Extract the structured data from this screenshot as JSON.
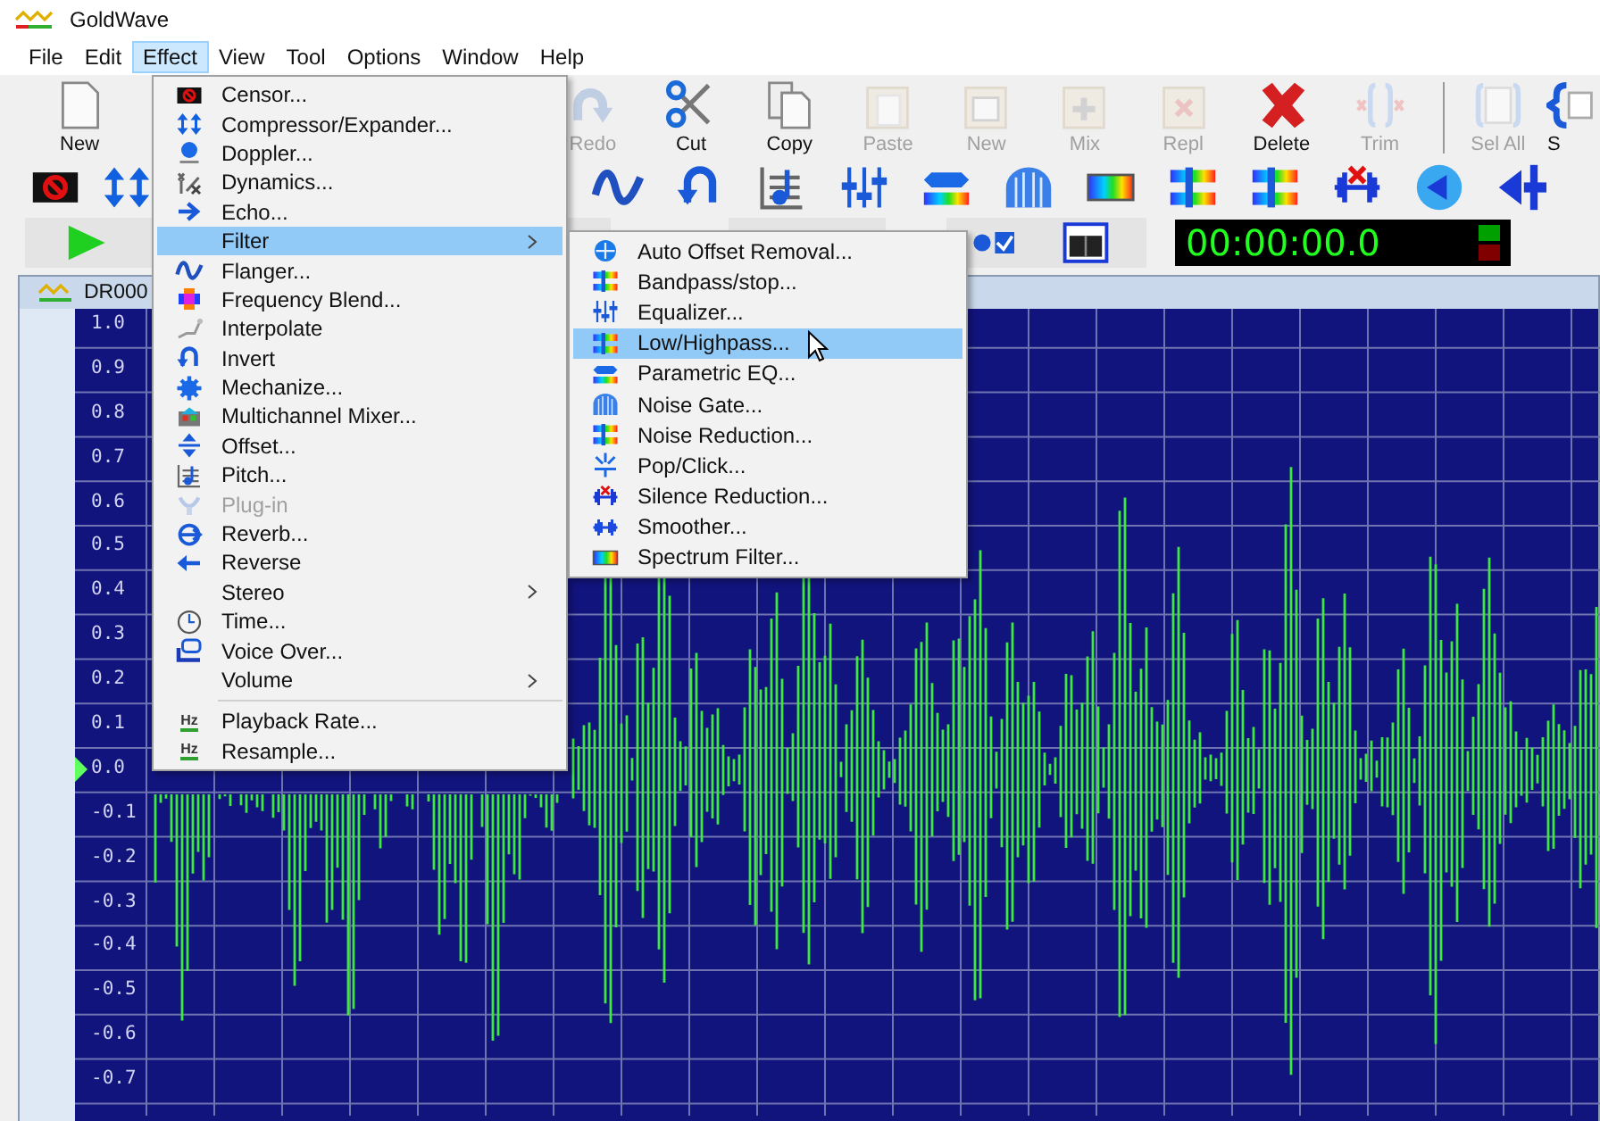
{
  "window": {
    "title": "GoldWave"
  },
  "menu_bar": [
    {
      "label": "File",
      "selected": false
    },
    {
      "label": "Edit",
      "selected": false
    },
    {
      "label": "Effect",
      "selected": true
    },
    {
      "label": "View",
      "selected": false
    },
    {
      "label": "Tool",
      "selected": false
    },
    {
      "label": "Options",
      "selected": false
    },
    {
      "label": "Window",
      "selected": false
    },
    {
      "label": "Help",
      "selected": false
    }
  ],
  "toolbar_left": [
    {
      "label": "New",
      "disabled": false
    }
  ],
  "toolbar_right": [
    {
      "label": "Redo",
      "disabled": true
    },
    {
      "label": "Cut",
      "disabled": false
    },
    {
      "label": "Copy",
      "disabled": false
    },
    {
      "label": "Paste",
      "disabled": true
    },
    {
      "label": "New",
      "disabled": true
    },
    {
      "label": "Mix",
      "disabled": true
    },
    {
      "label": "Repl",
      "disabled": true
    },
    {
      "label": "Delete",
      "disabled": false
    },
    {
      "label": "Trim",
      "disabled": true
    }
  ],
  "toolbar_end": [
    {
      "label": "Sel All",
      "disabled": true
    },
    {
      "label": "S",
      "disabled": false
    }
  ],
  "timer": {
    "value": "00:00:00.0"
  },
  "document": {
    "title": "DR000",
    "y_axis_labels": [
      "1.0",
      "0.9",
      "0.8",
      "0.7",
      "0.6",
      "0.5",
      "0.4",
      "0.3",
      "0.2",
      "0.1",
      "0.0",
      "-0.1",
      "-0.2",
      "-0.3",
      "-0.4",
      "-0.5",
      "-0.6",
      "-0.7"
    ]
  },
  "effect_menu": [
    {
      "label": "Censor...",
      "kind": "item",
      "disabled": false,
      "selected": false,
      "submenu": false
    },
    {
      "label": "Compressor/Expander...",
      "kind": "item",
      "disabled": false,
      "selected": false,
      "submenu": false
    },
    {
      "label": "Doppler...",
      "kind": "item",
      "disabled": false,
      "selected": false,
      "submenu": false
    },
    {
      "label": "Dynamics...",
      "kind": "item",
      "disabled": false,
      "selected": false,
      "submenu": false
    },
    {
      "label": "Echo...",
      "kind": "item",
      "disabled": false,
      "selected": false,
      "submenu": false
    },
    {
      "label": "Filter",
      "kind": "item",
      "disabled": false,
      "selected": true,
      "submenu": true
    },
    {
      "label": "Flanger...",
      "kind": "item",
      "disabled": false,
      "selected": false,
      "submenu": false
    },
    {
      "label": "Frequency Blend...",
      "kind": "item",
      "disabled": false,
      "selected": false,
      "submenu": false
    },
    {
      "label": "Interpolate",
      "kind": "item",
      "disabled": false,
      "selected": false,
      "submenu": false
    },
    {
      "label": "Invert",
      "kind": "item",
      "disabled": false,
      "selected": false,
      "submenu": false
    },
    {
      "label": "Mechanize...",
      "kind": "item",
      "disabled": false,
      "selected": false,
      "submenu": false
    },
    {
      "label": "Multichannel Mixer...",
      "kind": "item",
      "disabled": false,
      "selected": false,
      "submenu": false
    },
    {
      "label": "Offset...",
      "kind": "item",
      "disabled": false,
      "selected": false,
      "submenu": false
    },
    {
      "label": "Pitch...",
      "kind": "item",
      "disabled": false,
      "selected": false,
      "submenu": false
    },
    {
      "label": "Plug-in",
      "kind": "item",
      "disabled": true,
      "selected": false,
      "submenu": false
    },
    {
      "label": "Reverb...",
      "kind": "item",
      "disabled": false,
      "selected": false,
      "submenu": false
    },
    {
      "label": "Reverse",
      "kind": "item",
      "disabled": false,
      "selected": false,
      "submenu": false
    },
    {
      "label": "Stereo",
      "kind": "item",
      "disabled": false,
      "selected": false,
      "submenu": true
    },
    {
      "label": "Time...",
      "kind": "item",
      "disabled": false,
      "selected": false,
      "submenu": false
    },
    {
      "label": "Voice Over...",
      "kind": "item",
      "disabled": false,
      "selected": false,
      "submenu": false
    },
    {
      "label": "Volume",
      "kind": "item",
      "disabled": false,
      "selected": false,
      "submenu": true
    },
    {
      "kind": "separator"
    },
    {
      "label": "Playback Rate...",
      "kind": "item",
      "icon_text": "Hz",
      "disabled": false,
      "selected": false,
      "submenu": false
    },
    {
      "label": "Resample...",
      "kind": "item",
      "icon_text": "Hz",
      "disabled": false,
      "selected": false,
      "submenu": false
    }
  ],
  "filter_submenu": [
    {
      "label": "Auto Offset Removal...",
      "selected": false
    },
    {
      "label": "Bandpass/stop...",
      "selected": false
    },
    {
      "label": "Equalizer...",
      "selected": false
    },
    {
      "label": "Low/Highpass...",
      "selected": true
    },
    {
      "label": "Parametric EQ...",
      "selected": false
    },
    {
      "label": "Noise Gate...",
      "selected": false
    },
    {
      "label": "Noise Reduction...",
      "selected": false
    },
    {
      "label": "Pop/Click...",
      "selected": false
    },
    {
      "label": "Silence Reduction...",
      "selected": false
    },
    {
      "label": "Smoother...",
      "selected": false
    },
    {
      "label": "Spectrum Filter...",
      "selected": false
    }
  ]
}
